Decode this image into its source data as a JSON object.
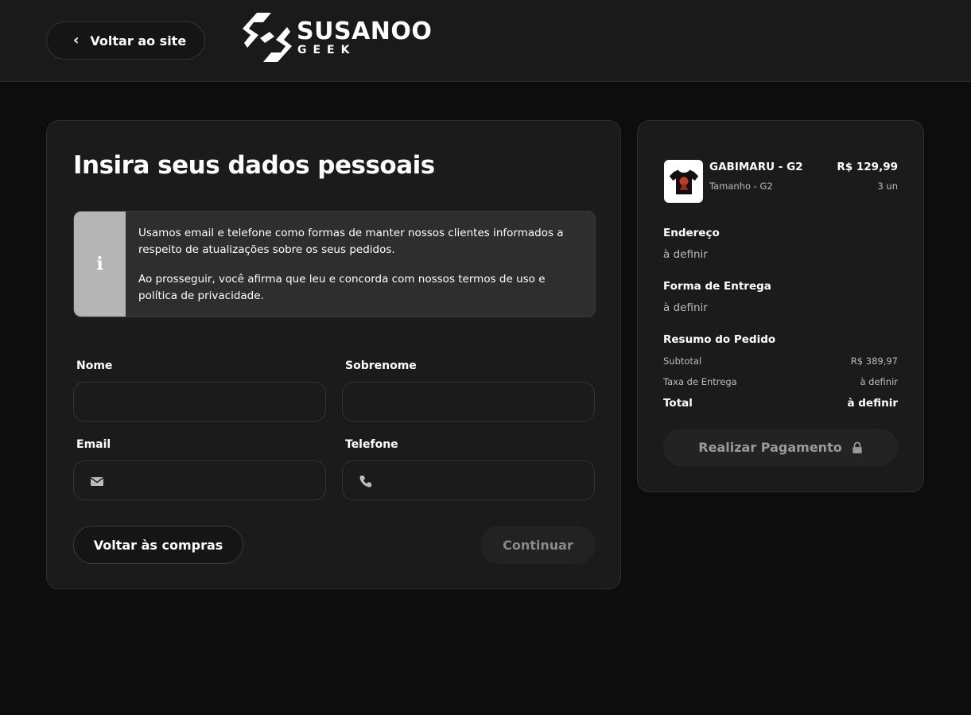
{
  "header": {
    "back_to_site_label": "Voltar ao site",
    "logo_main": "SUSANOO",
    "logo_sub": "GEEK"
  },
  "form": {
    "title": "Insira seus dados pessoais",
    "info_paragraph_1": "Usamos email e telefone como formas de manter nossos clientes informados a respeito de atualizações sobre os seus pedidos.",
    "info_paragraph_2": "Ao prosseguir, você afirma que leu e concorda com nossos termos de uso e política de privacidade.",
    "fields": {
      "nome_label": "Nome",
      "nome_value": "",
      "sobrenome_label": "Sobrenome",
      "sobrenome_value": "",
      "email_label": "Email",
      "email_value": "",
      "telefone_label": "Telefone",
      "telefone_value": ""
    },
    "back_button_label": "Voltar às compras",
    "continue_button_label": "Continuar"
  },
  "summary": {
    "product": {
      "name": "GABIMARU - G2",
      "size": "Tamanho - G2",
      "price": "R$ 129,99",
      "quantity": "3 un"
    },
    "address_title": "Endereço",
    "address_value": "à definir",
    "shipping_title": "Forma de Entrega",
    "shipping_value": "à definir",
    "order_summary_title": "Resumo do Pedido",
    "subtotal_label": "Subtotal",
    "subtotal_value": "R$ 389,97",
    "delivery_fee_label": "Taxa de Entrega",
    "delivery_fee_value": "à definir",
    "total_label": "Total",
    "total_value": "à definir",
    "pay_button_label": "Realizar Pagamento"
  },
  "icons": {
    "back": "chevron-left-icon",
    "info": "info-icon",
    "email": "envelope-icon",
    "phone": "phone-icon",
    "lock": "lock-icon"
  },
  "colors": {
    "background": "#0d0d0d",
    "card": "#1b1b1b",
    "info_icon_bg": "#b5b5b5",
    "muted_text": "#bbbbbb"
  }
}
